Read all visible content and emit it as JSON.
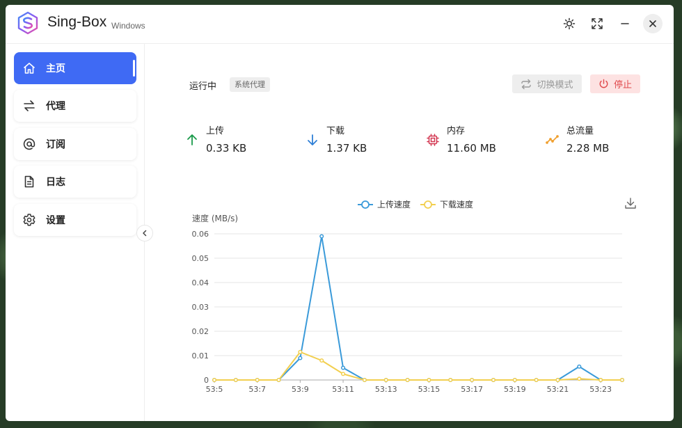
{
  "app": {
    "title": "Sing-Box",
    "subtitle": "Windows"
  },
  "sidebar": {
    "items": [
      {
        "label": "主页",
        "icon": "home-icon",
        "active": true
      },
      {
        "label": "代理",
        "icon": "swap-icon",
        "active": false
      },
      {
        "label": "订阅",
        "icon": "at-icon",
        "active": false
      },
      {
        "label": "日志",
        "icon": "document-icon",
        "active": false
      },
      {
        "label": "设置",
        "icon": "gear-icon",
        "active": false
      }
    ]
  },
  "status": {
    "running_text": "运行中",
    "mode_badge": "系统代理",
    "switch_mode_label": "切换模式",
    "stop_label": "停止"
  },
  "stats": [
    {
      "label": "上传",
      "value": "0.33 KB",
      "icon": "arrow-up-icon",
      "color": "#1a9a4a"
    },
    {
      "label": "下载",
      "value": "1.37 KB",
      "icon": "arrow-down-icon",
      "color": "#2f7fd6"
    },
    {
      "label": "内存",
      "value": "11.60 MB",
      "icon": "chip-icon",
      "color": "#d2344f"
    },
    {
      "label": "总流量",
      "value": "2.28 MB",
      "icon": "trend-icon",
      "color": "#f0a030"
    }
  ],
  "colors": {
    "accent": "#3f6af4",
    "upload_series": "#3a9ad9",
    "download_series": "#f2cf4f"
  },
  "chart_data": {
    "type": "line",
    "ylabel": "速度 (MB/s)",
    "ylim": [
      0,
      0.06
    ],
    "yticks": [
      0,
      0.01,
      0.02,
      0.03,
      0.04,
      0.05,
      0.06
    ],
    "x": [
      "53:5",
      "53:6",
      "53:7",
      "53:8",
      "53:9",
      "53:10",
      "53:11",
      "53:12",
      "53:13",
      "53:14",
      "53:15",
      "53:16",
      "53:17",
      "53:18",
      "53:19",
      "53:20",
      "53:21",
      "53:22",
      "53:23",
      "53:24"
    ],
    "xtick_labels": [
      "53:5",
      "53:7",
      "53:9",
      "53:11",
      "53:13",
      "53:15",
      "53:17",
      "53:19",
      "53:21",
      "53:23"
    ],
    "legend_position": "top-center",
    "grid": true,
    "series": [
      {
        "name": "上传速度",
        "color": "#3a9ad9",
        "values": [
          0,
          0,
          0,
          0,
          0.009,
          0.059,
          0.005,
          0,
          0,
          0,
          0,
          0,
          0,
          0,
          0,
          0,
          0,
          0.0055,
          0,
          0
        ]
      },
      {
        "name": "下载速度",
        "color": "#f2cf4f",
        "values": [
          0,
          0,
          0,
          0,
          0.0115,
          0.008,
          0.0025,
          0,
          0,
          0,
          0,
          0,
          0,
          0,
          0,
          0,
          0,
          0.0005,
          0,
          0
        ]
      }
    ]
  }
}
